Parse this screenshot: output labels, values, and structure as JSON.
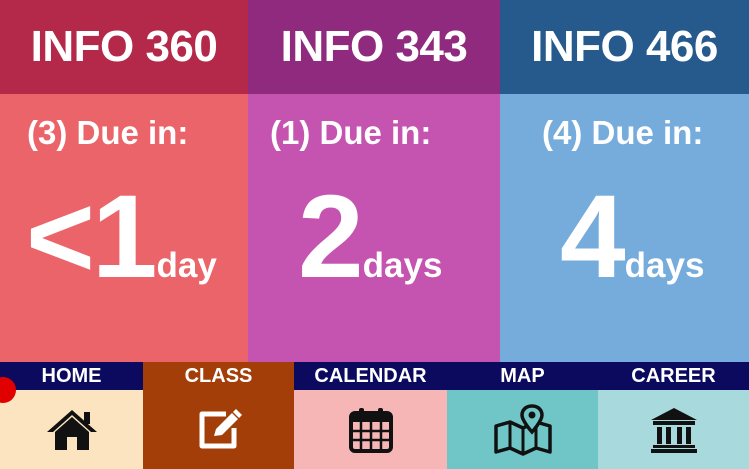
{
  "courses": [
    {
      "code": "INFO 360",
      "due_text": "(3) Due in:",
      "amount": "<1",
      "unit": "day",
      "head_color": "#b4294a",
      "body_color": "#eb6469"
    },
    {
      "code": "INFO 343",
      "due_text": "(1) Due in:",
      "amount": "2",
      "unit": "days",
      "head_color": "#8f2a7e",
      "body_color": "#c553b0"
    },
    {
      "code": "INFO 466",
      "due_text": "(4) Due in:",
      "amount": "4",
      "unit": "days",
      "head_color": "#265a8c",
      "body_color": "#76acdc"
    }
  ],
  "nav": [
    {
      "label": "HOME",
      "icon": "home-icon",
      "label_bg": "#0b0a5e",
      "icon_bg": "#fbe4bf"
    },
    {
      "label": "CLASS",
      "icon": "edit-icon",
      "label_bg": "#a33e09",
      "icon_bg": "#a33e09"
    },
    {
      "label": "CALENDAR",
      "icon": "calendar-icon",
      "label_bg": "#0b0a5e",
      "icon_bg": "#f7b6b6"
    },
    {
      "label": "MAP",
      "icon": "map-icon",
      "label_bg": "#0b0a5e",
      "icon_bg": "#70c6c6"
    },
    {
      "label": "CAREER",
      "icon": "institution-icon",
      "label_bg": "#0b0a5e",
      "icon_bg": "#a8dadd"
    }
  ]
}
